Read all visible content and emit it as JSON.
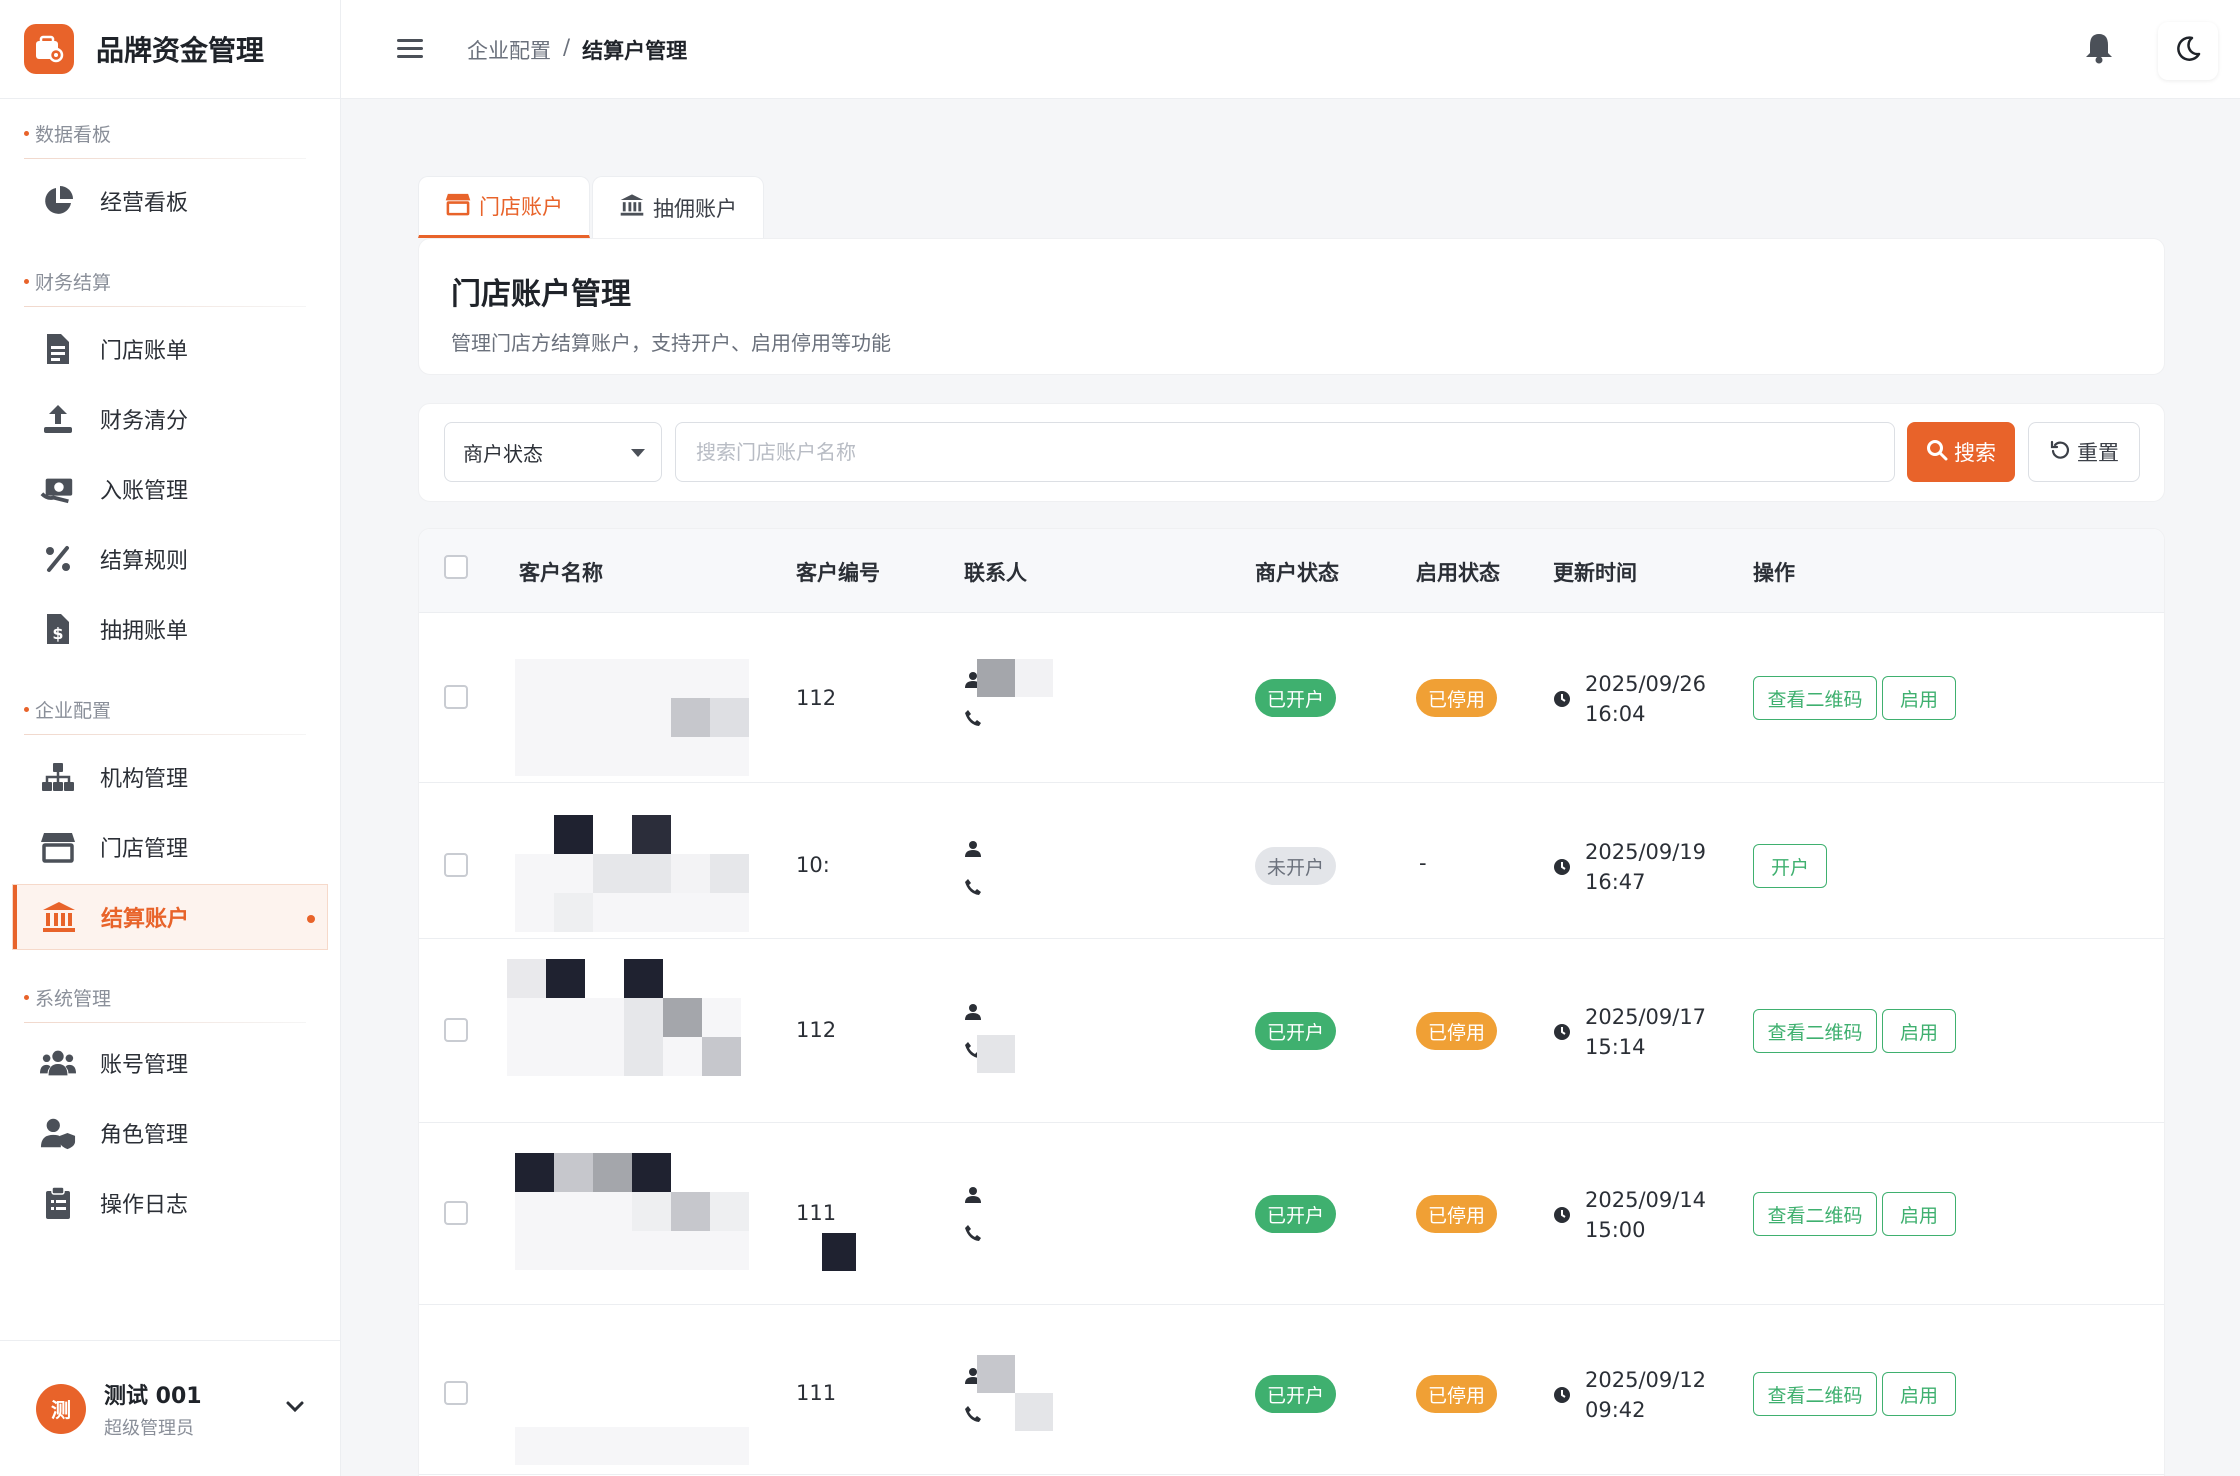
{
  "app": {
    "brand_title": "品牌资金管理"
  },
  "sidebar": {
    "sections": [
      {
        "title": "数据看板",
        "items": [
          {
            "label": "经营看板",
            "icon": "pie-chart-icon"
          }
        ]
      },
      {
        "title": "财务结算",
        "items": [
          {
            "label": "门店账单",
            "icon": "bill-icon"
          },
          {
            "label": "财务清分",
            "icon": "upload-icon"
          },
          {
            "label": "入账管理",
            "icon": "money-icon"
          },
          {
            "label": "结算规则",
            "icon": "percent-icon"
          },
          {
            "label": "抽拥账单",
            "icon": "invoice-dollar-icon"
          }
        ]
      },
      {
        "title": "企业配置",
        "items": [
          {
            "label": "机构管理",
            "icon": "org-tree-icon"
          },
          {
            "label": "门店管理",
            "icon": "store-icon"
          },
          {
            "label": "结算账户",
            "icon": "bank-icon",
            "active": true
          }
        ]
      },
      {
        "title": "系统管理",
        "items": [
          {
            "label": "账号管理",
            "icon": "users-icon"
          },
          {
            "label": "角色管理",
            "icon": "user-shield-icon"
          },
          {
            "label": "操作日志",
            "icon": "clipboard-icon"
          }
        ]
      }
    ],
    "user": {
      "avatar_text": "测",
      "name": "测试 001",
      "role": "超级管理员"
    }
  },
  "header": {
    "breadcrumb": {
      "parent": "企业配置",
      "separator": "/",
      "current": "结算户管理"
    }
  },
  "tabs": [
    {
      "label": "门店账户",
      "icon": "store-icon",
      "active": true
    },
    {
      "label": "抽佣账户",
      "icon": "bank-icon",
      "active": false
    }
  ],
  "page": {
    "title": "门店账户管理",
    "description": "管理门店方结算账户，支持开户、启用停用等功能"
  },
  "filter": {
    "status_select": "商户状态",
    "search_placeholder": "搜索门店账户名称",
    "search_button": "搜索",
    "reset_button": "重置"
  },
  "table": {
    "columns": [
      "客户名称",
      "客户编号",
      "联系人",
      "商户状态",
      "启用状态",
      "更新时间",
      "操作"
    ],
    "rows": [
      {
        "customer_no": "112",
        "merchant_status": "已开户",
        "enable_status": "已停用",
        "date": "2025/09/26",
        "time": "16:04",
        "actions": [
          "查看二维码",
          "启用"
        ]
      },
      {
        "customer_no": "10:",
        "merchant_status": "未开户",
        "enable_status": "-",
        "date": "2025/09/19",
        "time": "16:47",
        "actions": [
          "开户"
        ]
      },
      {
        "customer_no": "112",
        "merchant_status": "已开户",
        "enable_status": "已停用",
        "date": "2025/09/17",
        "time": "15:14",
        "actions": [
          "查看二维码",
          "启用"
        ]
      },
      {
        "customer_no": "111",
        "merchant_status": "已开户",
        "enable_status": "已停用",
        "date": "2025/09/14",
        "time": "15:00",
        "actions": [
          "查看二维码",
          "启用"
        ]
      },
      {
        "customer_no": "111",
        "merchant_status": "已开户",
        "enable_status": "已停用",
        "date": "2025/09/12",
        "time": "09:42",
        "actions": [
          "查看二维码",
          "启用"
        ]
      }
    ]
  },
  "colors": {
    "accent": "#e8632a",
    "success": "#3fb06f",
    "warning": "#f0a035"
  }
}
